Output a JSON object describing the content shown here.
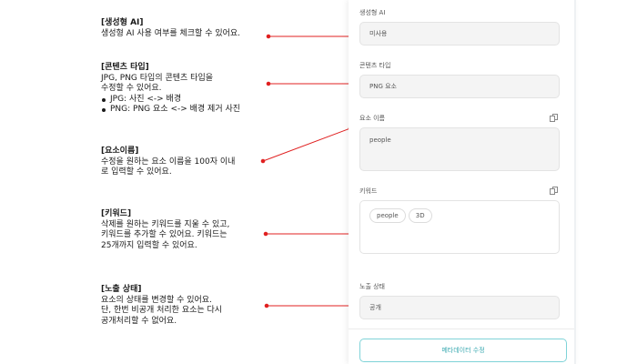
{
  "annotations": [
    {
      "title": "[생성형 AI]",
      "lines": [
        "생성형 AI 사용 여부를 체크할 수 있어요."
      ],
      "bullets": []
    },
    {
      "title": "[콘텐츠 타입]",
      "lines": [
        "JPG, PNG 타입의 콘텐츠 타입을",
        "수정할 수 있어요."
      ],
      "bullets": [
        "JPG: 사진 <-> 배경",
        "PNG: PNG 요소 <-> 배경 제거 사진"
      ]
    },
    {
      "title": "[요소이름]",
      "lines": [
        "수정을 원하는 요소 이름을 100자 이내",
        "로 입력할 수 있어요."
      ],
      "bullets": []
    },
    {
      "title": "[키워드]",
      "lines": [
        "삭제를 원하는 키워드를 지울 수 있고,",
        "키워드를 추가할 수 있어요. 키워드는",
        "25개까지 입력할 수 있어요."
      ],
      "bullets": []
    },
    {
      "title": "[노출 상태]",
      "lines": [
        "요소의 상태를 변경할 수 있어요.",
        "단, 한번 비공개 처리한 요소는 다시",
        "공개처리할 수 없어요."
      ],
      "bullets": []
    }
  ],
  "panel": {
    "ai": {
      "label": "생성형 AI",
      "value": "미사용"
    },
    "content_type": {
      "label": "콘텐츠 타입",
      "value": "PNG 요소"
    },
    "element_name": {
      "label": "요소 이름",
      "value": "people"
    },
    "keywords": {
      "label": "키워드",
      "tags": [
        "people",
        "3D"
      ]
    },
    "visibility": {
      "label": "노출 상태",
      "value": "공개"
    },
    "submit_label": "메타데이터 수정"
  },
  "colors": {
    "connector": "#e02020",
    "accent": "#3aa9b1",
    "field_bg": "#f4f4f4"
  }
}
